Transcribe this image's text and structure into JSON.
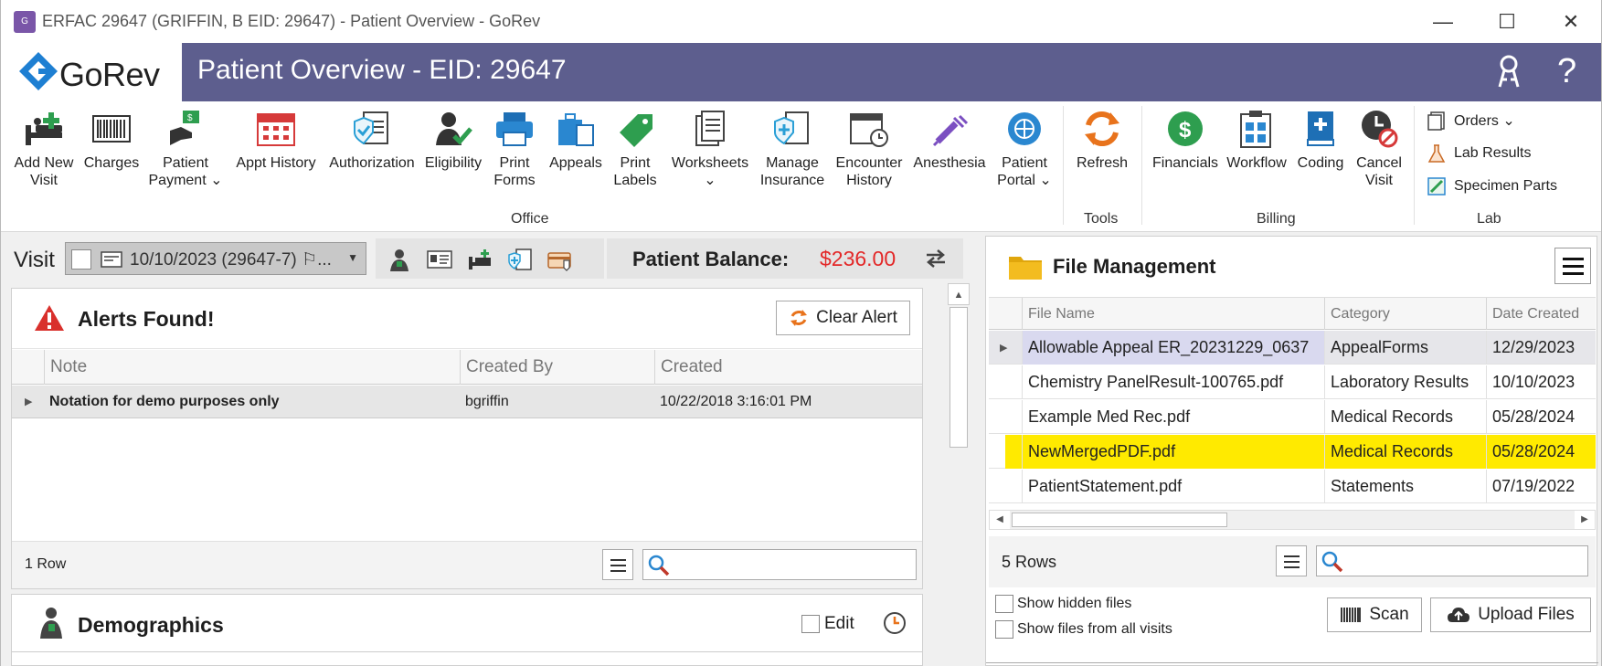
{
  "window": {
    "title": "ERFAC 29647 (GRIFFIN, B EID: 29647) - Patient Overview - GoRev",
    "controls": {
      "minimize": "—",
      "maximize": "☐",
      "close": "✕"
    }
  },
  "header": {
    "logo_text": "GoRev",
    "page_title": "Patient Overview - EID: 29647",
    "icons": [
      "key-icon",
      "help-icon"
    ],
    "help_label": "?"
  },
  "ribbon": {
    "office": {
      "label": "Office",
      "buttons": [
        {
          "label": "Add New\nVisit",
          "icon": "bed-plus-icon"
        },
        {
          "label": "Charges",
          "icon": "barcode-icon"
        },
        {
          "label": "Patient\nPayment ⌄",
          "icon": "payment-hand-icon"
        },
        {
          "label": "Appt History",
          "icon": "calendar-icon"
        },
        {
          "label": "Authorization",
          "icon": "shield-check-icon"
        },
        {
          "label": "Eligibility",
          "icon": "user-check-icon"
        },
        {
          "label": "Print\nForms",
          "icon": "printer-icon"
        },
        {
          "label": "Appeals",
          "icon": "briefcase-icon"
        },
        {
          "label": "Print\nLabels",
          "icon": "tag-icon"
        },
        {
          "label": "Worksheets\n⌄",
          "icon": "documents-icon"
        },
        {
          "label": "Manage\nInsurance",
          "icon": "insurance-icon"
        },
        {
          "label": "Encounter\nHistory",
          "icon": "calendar-clock-icon"
        },
        {
          "label": "Anesthesia",
          "icon": "syringe-icon"
        },
        {
          "label": "Patient\nPortal ⌄",
          "icon": "globe-gear-icon"
        }
      ]
    },
    "tools": {
      "label": "Tools",
      "buttons": [
        {
          "label": "Refresh",
          "icon": "refresh-icon"
        }
      ]
    },
    "billing": {
      "label": "Billing",
      "buttons": [
        {
          "label": "Financials",
          "icon": "dollar-icon"
        },
        {
          "label": "Workflow",
          "icon": "clipboard-grid-icon"
        },
        {
          "label": "Coding",
          "icon": "book-plus-icon"
        },
        {
          "label": "Cancel\nVisit",
          "icon": "clock-cancel-icon"
        }
      ]
    },
    "lab": {
      "label": "Lab",
      "items": [
        {
          "label": "Orders ⌄",
          "icon": "orders-icon"
        },
        {
          "label": "Lab Results",
          "icon": "flask-icon"
        },
        {
          "label": "Specimen Parts",
          "icon": "specimen-icon"
        }
      ]
    }
  },
  "visit": {
    "label": "Visit",
    "selected": "10/10/2023 (29647-7) ⚐...",
    "balance_label": "Patient Balance:",
    "balance_amount": "$236.00"
  },
  "alerts": {
    "title": "Alerts Found!",
    "clear_button": "Clear Alert",
    "columns": [
      "Note",
      "Created By",
      "Created"
    ],
    "rows": [
      {
        "note": "Notation for demo purposes only",
        "created_by": "bgriffin",
        "created": "10/22/2018 3:16:01 PM"
      }
    ],
    "row_count": "1 Row"
  },
  "demographics": {
    "title": "Demographics",
    "edit_label": "Edit"
  },
  "files": {
    "title": "File Management",
    "columns": [
      "File Name",
      "Category",
      "Date Created"
    ],
    "rows": [
      {
        "name": "Allowable Appeal ER_20231229_0637",
        "category": "AppealForms",
        "date": "12/29/2023"
      },
      {
        "name": "Chemistry PanelResult-100765.pdf",
        "category": "Laboratory Results",
        "date": "10/10/2023"
      },
      {
        "name": "Example Med Rec.pdf",
        "category": "Medical Records",
        "date": "05/28/2024"
      },
      {
        "name": "NewMergedPDF.pdf",
        "category": "Medical Records",
        "date": "05/28/2024"
      },
      {
        "name": "PatientStatement.pdf",
        "category": "Statements",
        "date": "07/19/2022"
      }
    ],
    "row_count": "5 Rows",
    "show_hidden": "Show hidden files",
    "show_all_visits": "Show files from all visits",
    "scan_button": "Scan",
    "upload_button": "Upload Files"
  },
  "colors": {
    "header_bg": "#5d5e8e",
    "balance_red": "#e32828",
    "highlight_yellow": "#ffea00",
    "accent_blue": "#1e6fb5",
    "green": "#2e8b57"
  }
}
